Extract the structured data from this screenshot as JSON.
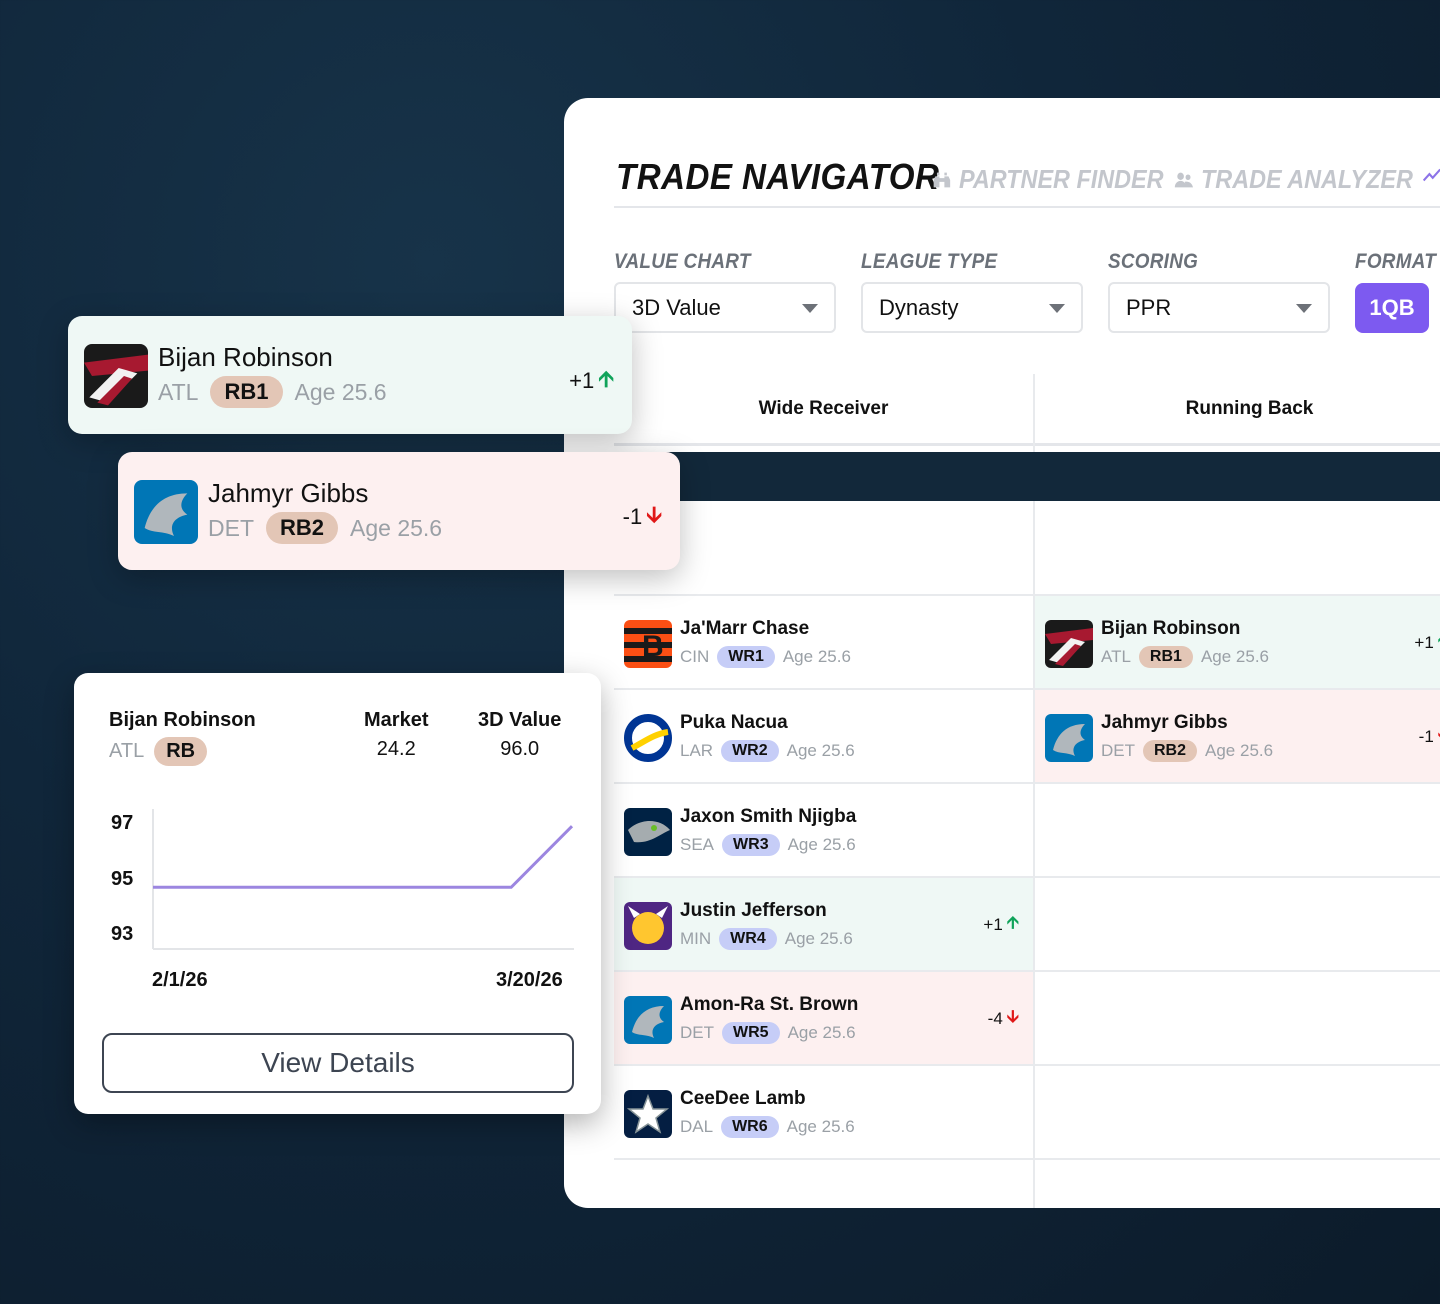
{
  "nav": {
    "title": "TRADE NAVIGATOR",
    "links": [
      "PARTNER FINDER",
      "TRADE ANALYZER"
    ]
  },
  "filters": {
    "value_chart": {
      "label": "VALUE CHART",
      "value": "3D Value"
    },
    "league_type": {
      "label": "LEAGUE TYPE",
      "value": "Dynasty"
    },
    "scoring": {
      "label": "SCORING",
      "value": "PPR"
    },
    "format": {
      "label": "FORMAT",
      "value": "1QB"
    }
  },
  "columns": [
    "Wide Receiver",
    "Running Back"
  ],
  "wide_receivers": [
    {
      "name": "Ja'Marr Chase",
      "team": "CIN",
      "rank": "WR1",
      "age": "Age 25.6",
      "delta": "",
      "trend": "none",
      "team_color": "#fb4f14"
    },
    {
      "name": "Puka Nacua",
      "team": "LAR",
      "rank": "WR2",
      "age": "Age 25.6",
      "delta": "",
      "trend": "none",
      "team_color": "#003594"
    },
    {
      "name": "Jaxon Smith Njigba",
      "team": "SEA",
      "rank": "WR3",
      "age": "Age 25.6",
      "delta": "",
      "trend": "none",
      "team_color": "#002244"
    },
    {
      "name": "Justin Jefferson",
      "team": "MIN",
      "rank": "WR4",
      "age": "Age 25.6",
      "delta": "+1",
      "trend": "up",
      "team_color": "#4f2683"
    },
    {
      "name": "Amon-Ra St. Brown",
      "team": "DET",
      "rank": "WR5",
      "age": "Age 25.6",
      "delta": "-4",
      "trend": "down",
      "team_color": "#0076b6"
    },
    {
      "name": "CeeDee Lamb",
      "team": "DAL",
      "rank": "WR6",
      "age": "Age 25.6",
      "delta": "",
      "trend": "none",
      "team_color": "#041e42"
    }
  ],
  "running_backs": [
    {
      "name": "Bijan Robinson",
      "team": "ATL",
      "rank": "RB1",
      "age": "Age 25.6",
      "delta": "+1",
      "trend": "up",
      "team_color": "#a71930"
    },
    {
      "name": "Jahmyr Gibbs",
      "team": "DET",
      "rank": "RB2",
      "age": "Age 25.6",
      "delta": "-1",
      "trend": "down",
      "team_color": "#0076b6"
    }
  ],
  "float_cards": [
    {
      "name": "Bijan Robinson",
      "team": "ATL",
      "rank": "RB1",
      "age": "Age 25.6",
      "delta": "+1",
      "trend": "up"
    },
    {
      "name": "Jahmyr Gibbs",
      "team": "DET",
      "rank": "RB2",
      "age": "Age 25.6",
      "delta": "-1",
      "trend": "down"
    }
  ],
  "detail": {
    "name": "Bijan Robinson",
    "team": "ATL",
    "position": "RB",
    "market_label": "Market",
    "market_value": "24.2",
    "value_label": "3D Value",
    "value": "96.0",
    "button": "View Details"
  },
  "chart_data": {
    "type": "line",
    "x": [
      "2/1/26",
      "3/12/26",
      "3/20/26"
    ],
    "series": [
      {
        "values": [
          94.9,
          94.9,
          97.2
        ]
      }
    ],
    "yticks": [
      97,
      95,
      93
    ],
    "xtick_labels": [
      "2/1/26",
      "3/20/26"
    ],
    "ylim": [
      92.5,
      98
    ],
    "line_color": "#9c86e0",
    "grid": false
  },
  "colors": {
    "accent": "#7d5af0",
    "up": "#10a35a",
    "down": "#e01818",
    "wr_badge": "#c6cdf7",
    "rb_badge": "#e3c6b6"
  }
}
